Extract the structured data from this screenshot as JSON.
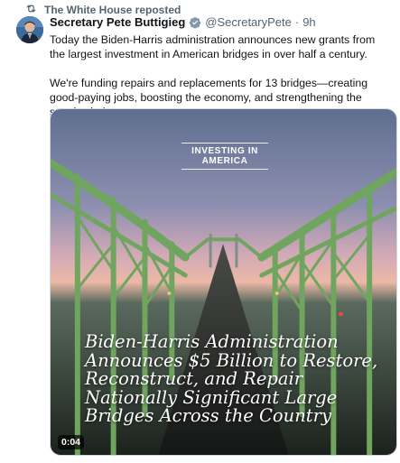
{
  "repost": {
    "label": "The White House reposted",
    "icon": "repost-icon"
  },
  "tweet": {
    "author_name": "Secretary Pete Buttigieg",
    "handle": "@SecretaryPete",
    "separator": "·",
    "time": "9h",
    "paragraphs": [
      "Today the Biden-Harris administration announces new grants from the largest investment in American bridges in over half a century.",
      "We're funding repairs and replacements for 13 bridges—creating good-paying jobs, boosting the economy, and strengthening the supply chain."
    ]
  },
  "media": {
    "badge": "INVESTING IN AMERICA",
    "headline": "Biden-Harris Administration Announces $5 Billion to Restore, Reconstruct, and Repair Nationally Significant Large Bridges Across the Country",
    "duration": "0:04"
  },
  "colors": {
    "verified": "#829aab",
    "bridge": "#6fa55f",
    "text_muted": "#536471"
  }
}
